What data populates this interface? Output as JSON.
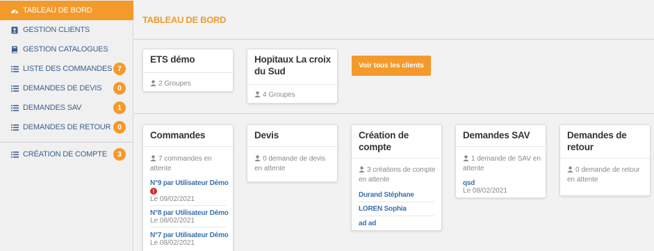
{
  "sidebar": {
    "items": [
      {
        "label": "TABLEAU DE BORD",
        "icon": "dashboard-icon",
        "badge": null
      },
      {
        "label": "GESTION CLIENTS",
        "icon": "address-book-icon",
        "badge": null
      },
      {
        "label": "GESTION CATALOGUES",
        "icon": "book-icon",
        "badge": null
      },
      {
        "label": "LISTE DES COMMANDES",
        "icon": "list-icon",
        "badge": "7"
      },
      {
        "label": "DEMANDES DE DEVIS",
        "icon": "list-icon",
        "badge": "0"
      },
      {
        "label": "DEMANDES SAV",
        "icon": "list-icon",
        "badge": "1"
      },
      {
        "label": "DEMANDES DE RETOUR",
        "icon": "list-icon",
        "badge": "0"
      },
      {
        "label": "CRÉATION DE COMPTE",
        "icon": "list-icon",
        "badge": "3"
      }
    ]
  },
  "main": {
    "title": "TABLEAU DE BORD",
    "clients": [
      {
        "name": "ETS démo",
        "groups": "2 Groupes"
      },
      {
        "name": "Hopitaux La croix du Sud",
        "groups": "4 Groupes"
      }
    ],
    "see_all_clients": "Voir tous les clients",
    "cards": {
      "commandes": {
        "title": "Commandes",
        "summary": "7 commandes en attente",
        "items": [
          {
            "label": "N°9 par Utilisateur Démo",
            "date": "Le 09/02/2021",
            "alert": "!"
          },
          {
            "label": "N°8 par Utilisateur Démo",
            "date": "Le 08/02/2021"
          },
          {
            "label": "N°7 par Utilisateur Démo",
            "date": "Le 08/02/2021"
          }
        ]
      },
      "devis": {
        "title": "Devis",
        "summary": "0 demande de devis en attente"
      },
      "creation": {
        "title": "Création de compte",
        "summary": "3 créations de compte en attente",
        "items": [
          "Durand Stéphane",
          "LOREN Sophia",
          "ad ad"
        ]
      },
      "sav": {
        "title": "Demandes SAV",
        "summary": "1 demande de SAV en attente",
        "items": [
          {
            "label": "qsd",
            "date": "Le 08/02/2021"
          }
        ]
      },
      "retour": {
        "title": "Demandes de retour",
        "summary": "0 demande de retour en attente"
      }
    }
  },
  "colors": {
    "accent": "#f39a2b",
    "link": "#3b6fad",
    "sidebar_text": "#3b5f8a",
    "alert": "#c9302c"
  }
}
